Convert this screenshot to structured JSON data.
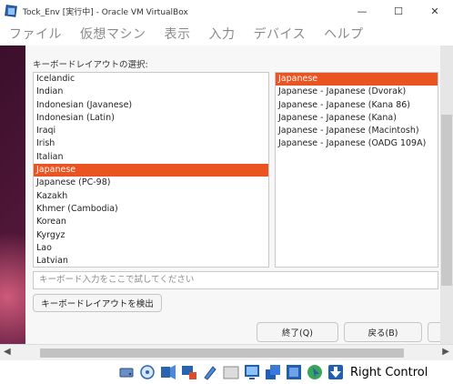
{
  "window": {
    "title": "Tock_Env [実行中] - Oracle VM VirtualBox",
    "minimize_glyph": "—",
    "maximize_glyph": "☐",
    "close_glyph": "✕"
  },
  "menu": {
    "items": [
      "ファイル",
      "仮想マシン",
      "表示",
      "入力",
      "デバイス",
      "ヘルプ"
    ]
  },
  "installer": {
    "select_label": "キーボードレイアウトの選択:",
    "layouts": [
      "Icelandic",
      "Indian",
      "Indonesian (Javanese)",
      "Indonesian (Latin)",
      "Iraqi",
      "Irish",
      "Italian",
      "Japanese",
      "Japanese (PC-98)",
      "Kazakh",
      "Khmer (Cambodia)",
      "Korean",
      "Kyrgyz",
      "Lao",
      "Latvian"
    ],
    "selected_layout_index": 7,
    "variants": [
      "Japanese",
      "Japanese - Japanese (Dvorak)",
      "Japanese - Japanese (Kana 86)",
      "Japanese - Japanese (Kana)",
      "Japanese - Japanese (Macintosh)",
      "Japanese - Japanese (OADG 109A)"
    ],
    "selected_variant_index": 0,
    "test_placeholder": "キーボード入力をここで試してください",
    "detect_button": "キーボードレイアウトを検出",
    "quit_button": "終了(Q)",
    "back_button": "戻る(B)"
  },
  "statusbar": {
    "host_key": "Right Control",
    "icons": [
      "hard-disk-icon",
      "optical-drive-icon",
      "audio-icon",
      "network-icon",
      "usb-icon",
      "shared-folder-icon",
      "display-icon",
      "recording-icon",
      "cpu-icon",
      "mouse-integration-icon",
      "host-key-arrow-icon"
    ]
  },
  "colors": {
    "selection": "#e95420",
    "desktop": "#5a1a3e",
    "vbox_blue": "#1f5fb5"
  }
}
